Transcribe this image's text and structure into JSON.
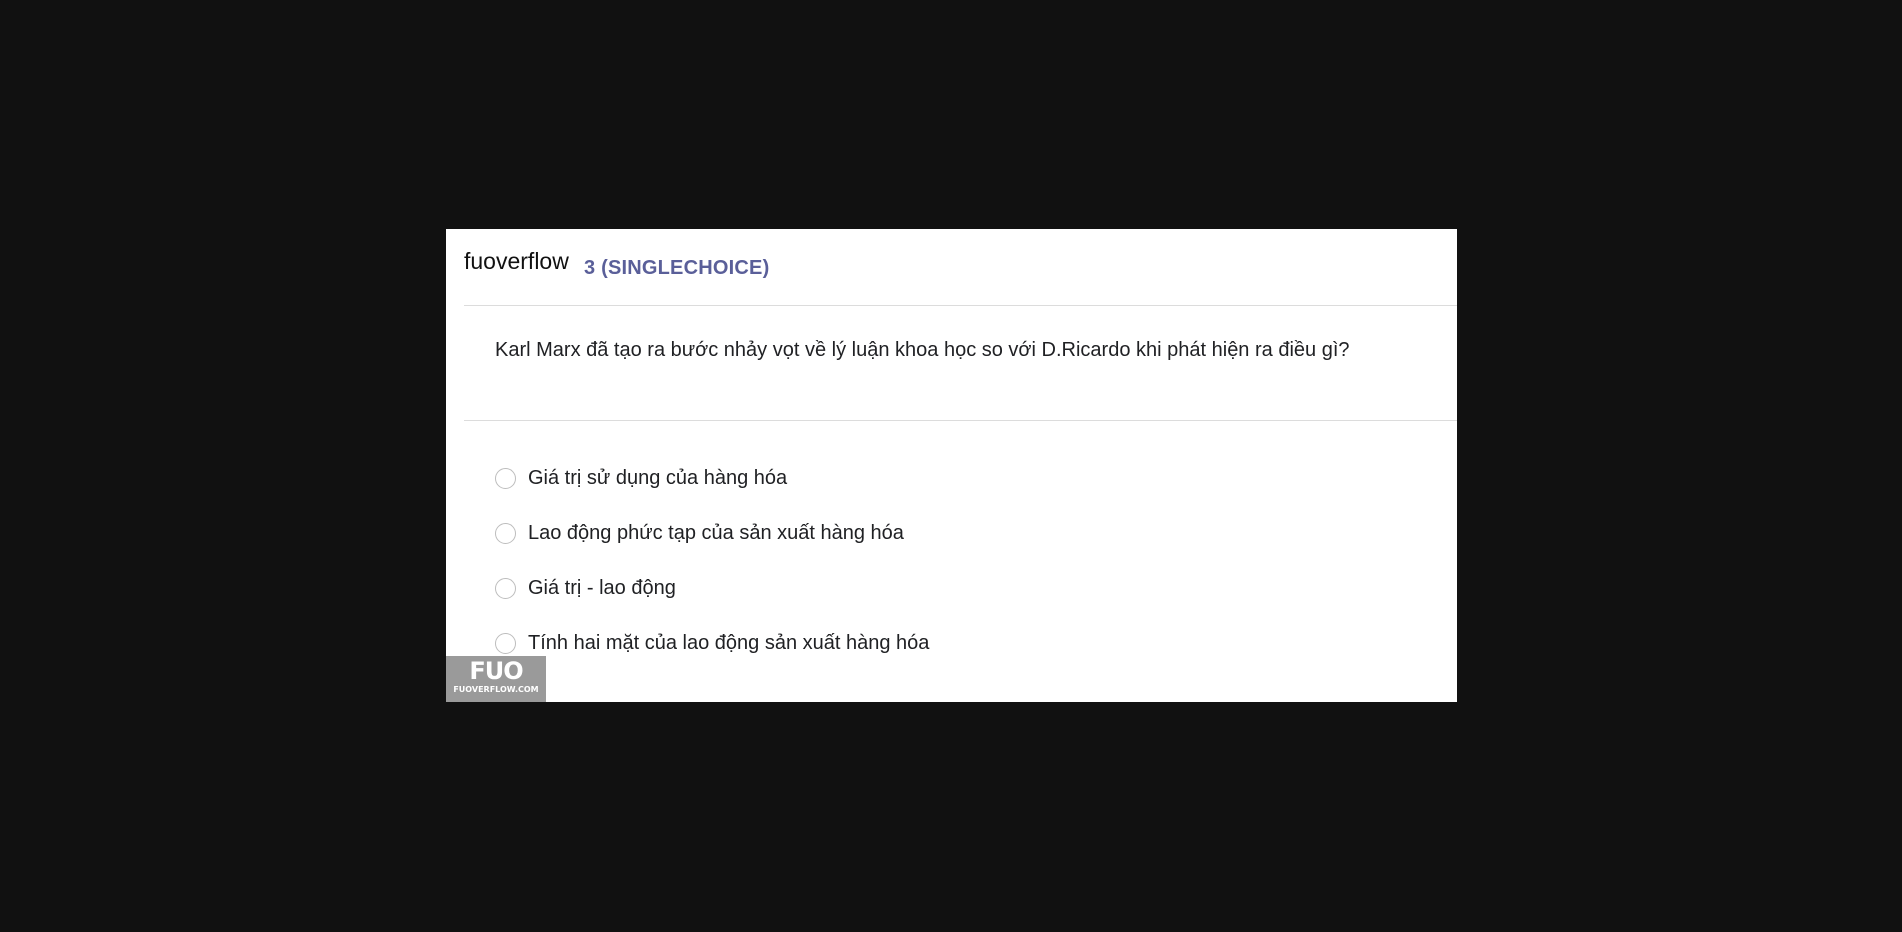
{
  "brand": "fuoverflow",
  "question_type": "3 (SINGLECHOICE)",
  "question": "Karl Marx đã tạo ra bước nhảy vọt về lý luận khoa học so với D.Ricardo khi phát hiện ra điều gì?",
  "options": [
    {
      "label": "Giá trị sử dụng của hàng hóa",
      "selected": false
    },
    {
      "label": "Lao động phức tạp của sản xuất hàng hóa",
      "selected": false
    },
    {
      "label": "Giá trị - lao động",
      "selected": false
    },
    {
      "label": "Tính hai mặt của lao động sản xuất hàng hóa",
      "selected": false
    }
  ],
  "watermark": {
    "logo": "FUO",
    "domain": "FUOVERFLOW.COM"
  },
  "colors": {
    "background": "#111111",
    "card": "#ffffff",
    "type_label": "#5a5f99"
  }
}
